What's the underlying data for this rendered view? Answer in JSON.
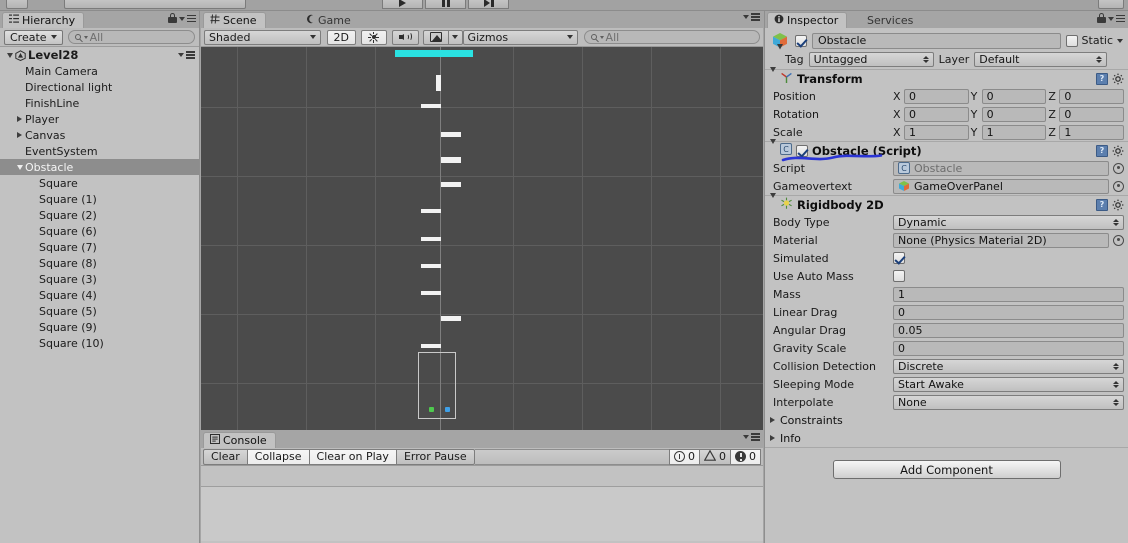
{
  "top_toolbar": {
    "play_icon": "play-icon",
    "pause_icon": "pause-icon",
    "step_icon": "step-icon"
  },
  "hierarchy": {
    "tab_label": "Hierarchy",
    "tab_icon": "hierarchy-icon",
    "lock_icon": "lock-icon",
    "menu_icon": "panel-menu-icon",
    "create_label": "Create",
    "search_placeholder": "All",
    "search_icon": "search-icon",
    "root": {
      "label": "Level28",
      "icon": "unity-logo-icon"
    },
    "items": [
      {
        "label": "Main Camera",
        "indent": 1,
        "foldout": "none",
        "selected": false
      },
      {
        "label": "Directional light",
        "indent": 1,
        "foldout": "none",
        "selected": false
      },
      {
        "label": "FinishLine",
        "indent": 1,
        "foldout": "none",
        "selected": false
      },
      {
        "label": "Player",
        "indent": 1,
        "foldout": "collapsed",
        "selected": false
      },
      {
        "label": "Canvas",
        "indent": 1,
        "foldout": "collapsed",
        "selected": false
      },
      {
        "label": "EventSystem",
        "indent": 1,
        "foldout": "none",
        "selected": false
      },
      {
        "label": "Obstacle",
        "indent": 1,
        "foldout": "expanded",
        "selected": true
      },
      {
        "label": "Square",
        "indent": 2,
        "foldout": "none",
        "selected": false
      },
      {
        "label": "Square (1)",
        "indent": 2,
        "foldout": "none",
        "selected": false
      },
      {
        "label": "Square (2)",
        "indent": 2,
        "foldout": "none",
        "selected": false
      },
      {
        "label": "Square (6)",
        "indent": 2,
        "foldout": "none",
        "selected": false
      },
      {
        "label": "Square (7)",
        "indent": 2,
        "foldout": "none",
        "selected": false
      },
      {
        "label": "Square (8)",
        "indent": 2,
        "foldout": "none",
        "selected": false
      },
      {
        "label": "Square (3)",
        "indent": 2,
        "foldout": "none",
        "selected": false
      },
      {
        "label": "Square (4)",
        "indent": 2,
        "foldout": "none",
        "selected": false
      },
      {
        "label": "Square (5)",
        "indent": 2,
        "foldout": "none",
        "selected": false
      },
      {
        "label": "Square (9)",
        "indent": 2,
        "foldout": "none",
        "selected": false
      },
      {
        "label": "Square (10)",
        "indent": 2,
        "foldout": "none",
        "selected": false
      }
    ]
  },
  "scene": {
    "tabs": [
      {
        "label": "Scene",
        "icon": "scene-grid-icon",
        "active": true
      },
      {
        "label": "Game",
        "icon": "game-moon-icon",
        "active": false
      }
    ],
    "menu_icon": "panel-menu-icon",
    "toolbar": {
      "draw_mode": "Shaded",
      "mode_2d": "2D",
      "lighting_icon": "sun-icon",
      "audio_icon": "audio-icon",
      "effects_icon": "image-icon",
      "effects_caret_icon": "chevron-down-icon",
      "gizmos_label": "Gizmos",
      "search_placeholder": "All",
      "search_icon": "search-icon"
    },
    "viewport": {
      "background_color": "#4b4b4b",
      "grid_color": "#5e5e5e",
      "obstacle_color": "#f2f2f2",
      "finish_line_color": "#2ae2e2",
      "selection_color": "#c9c9c9",
      "handle_green": "#4ec94e",
      "handle_blue": "#3fa0e8"
    }
  },
  "console": {
    "tab_label": "Console",
    "tab_icon": "console-icon",
    "menu_icon": "panel-menu-icon",
    "buttons": [
      {
        "label": "Clear",
        "active": false
      },
      {
        "label": "Collapse",
        "active": true
      },
      {
        "label": "Clear on Play",
        "active": true
      },
      {
        "label": "Error Pause",
        "active": false
      }
    ],
    "counters": [
      {
        "icon": "info-icon",
        "count": "0",
        "active": true
      },
      {
        "icon": "warning-icon",
        "count": "0",
        "active": false
      },
      {
        "icon": "error-icon",
        "count": "0",
        "active": true
      }
    ]
  },
  "inspector": {
    "tabs": [
      {
        "label": "Inspector",
        "icon": "info-icon",
        "active": true
      },
      {
        "label": "Services",
        "icon": "",
        "active": false
      }
    ],
    "lock_icon": "lock-icon",
    "menu_icon": "panel-menu-icon",
    "header": {
      "gameobject_icon": "gameobject-cube-icon",
      "enabled": true,
      "name": "Obstacle",
      "static_label": "Static",
      "static_checked": false,
      "static_caret_icon": "chevron-down-icon",
      "tag_label": "Tag",
      "tag_value": "Untagged",
      "layer_label": "Layer",
      "layer_value": "Default"
    },
    "components": [
      {
        "id": "transform",
        "title": "Transform",
        "icon": "transform-axis-icon",
        "help_icon": "help-icon",
        "gear_icon": "gear-icon",
        "expanded": true,
        "rows": [
          {
            "type": "vector3",
            "label": "Position",
            "x": "0",
            "y": "0",
            "z": "0"
          },
          {
            "type": "vector3",
            "label": "Rotation",
            "x": "0",
            "y": "0",
            "z": "0"
          },
          {
            "type": "vector3",
            "label": "Scale",
            "x": "1",
            "y": "1",
            "z": "1"
          }
        ]
      },
      {
        "id": "obstacle-script",
        "title": "Obstacle (Script)",
        "icon": "csharp-script-icon",
        "help_icon": "help-icon",
        "gear_icon": "gear-icon",
        "enabled": true,
        "expanded": true,
        "annotated": true,
        "annotation_color": "#2b35d6",
        "rows": [
          {
            "type": "object",
            "label": "Script",
            "value": "Obstacle",
            "dim": true,
            "icon": "csharp-script-icon",
            "picker": true
          },
          {
            "type": "object",
            "label": "Gameovertext",
            "value": "GameOverPanel",
            "dim": false,
            "icon": "prefab-cube-icon",
            "picker": true
          }
        ]
      },
      {
        "id": "rigidbody2d",
        "title": "Rigidbody 2D",
        "icon": "rigidbody2d-icon",
        "help_icon": "help-icon",
        "gear_icon": "gear-icon",
        "expanded": true,
        "rows": [
          {
            "type": "dropdown",
            "label": "Body Type",
            "value": "Dynamic"
          },
          {
            "type": "object",
            "label": "Material",
            "value": "None (Physics Material 2D)",
            "picker": true
          },
          {
            "type": "checkbox",
            "label": "Simulated",
            "checked": true
          },
          {
            "type": "checkbox",
            "label": "Use Auto Mass",
            "checked": false
          },
          {
            "type": "text",
            "label": "Mass",
            "value": "1"
          },
          {
            "type": "text",
            "label": "Linear Drag",
            "value": "0"
          },
          {
            "type": "text",
            "label": "Angular Drag",
            "value": "0.05"
          },
          {
            "type": "text",
            "label": "Gravity Scale",
            "value": "0"
          },
          {
            "type": "dropdown",
            "label": "Collision Detection",
            "value": "Discrete"
          },
          {
            "type": "dropdown",
            "label": "Sleeping Mode",
            "value": "Start Awake"
          },
          {
            "type": "dropdown",
            "label": "Interpolate",
            "value": "None"
          },
          {
            "type": "foldout",
            "label": "Constraints"
          },
          {
            "type": "foldout",
            "label": "Info"
          }
        ]
      }
    ],
    "add_component_label": "Add Component"
  }
}
